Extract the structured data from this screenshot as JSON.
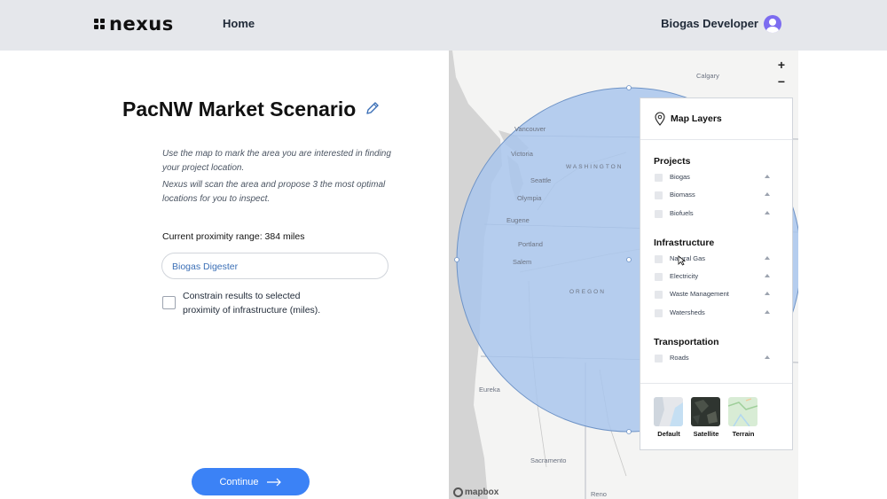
{
  "header": {
    "brand": "nexus",
    "nav_home": "Home",
    "user_name": "Biogas Developer",
    "avatar_color": "#7c6cf0"
  },
  "main": {
    "title": "PacNW Market Scenario",
    "description_1": "Use the map to mark the area you are interested in finding your project location.",
    "description_2": "Nexus will scan the area and propose 3 the most optimal locations for you to inspect.",
    "proximity_label": "Current proximity range: 384 miles",
    "facility_select_value": "Biogas Digester",
    "constrain_label_1": "Constrain results to selected",
    "constrain_label_2": "proximity of infrastructure (miles).",
    "constrain_checked": false,
    "continue_label": "Continue",
    "accent_color": "#3b82f6"
  },
  "map": {
    "cities": [
      "Calgary",
      "Vancouver",
      "Victoria",
      "Seattle",
      "Olympia",
      "Salem",
      "Portland",
      "Eugene",
      "Eureka",
      "Sacramento",
      "Reno"
    ],
    "regions": [
      "WASHINGTON",
      "OREGON"
    ],
    "attribution": "mapbox",
    "zoom_in": "+",
    "zoom_out": "−",
    "selection_color": "#a9c5ec"
  },
  "layers_panel": {
    "title": "Map Layers",
    "sections": [
      {
        "title": "Projects",
        "items": [
          "Biogas",
          "Biomass",
          "Biofuels"
        ]
      },
      {
        "title": "Infrastructure",
        "items": [
          "Natural Gas",
          "Electricity",
          "Waste Management",
          "Watersheds"
        ]
      },
      {
        "title": "Transportation",
        "items": [
          "Roads"
        ]
      }
    ],
    "styles": [
      "Default",
      "Satellite",
      "Terrain"
    ]
  }
}
